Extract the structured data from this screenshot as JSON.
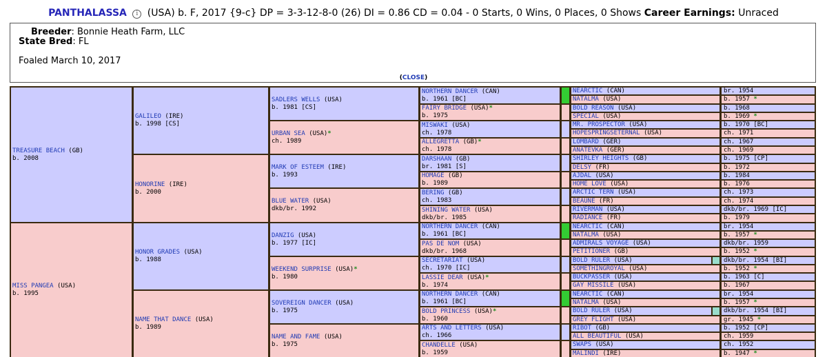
{
  "header": {
    "horse_name": "PANTHALASSA",
    "info_icon": "info-icon",
    "details": "(USA) b. F, 2017 {9-c} DP = 3-3-12-8-0 (26) DI = 0.86   CD = 0.04 - 0 Starts, 0 Wins, 0 Places, 0 Shows",
    "earnings_label": "Career Earnings:",
    "earnings_value": "Unraced"
  },
  "info": {
    "breeder_label": "Breeder",
    "breeder_value": ": Bonnie Heath Farm, LLC",
    "state_label": "State Bred",
    "state_value": ": FL",
    "foaled": "Foaled March 10, 2017",
    "close_paren_open": "(",
    "close_label": "CLOSE",
    "close_paren_close": ")"
  },
  "colors": {
    "male_bg": "#ccccff",
    "female_bg": "#f8cccc",
    "border": "#3a2a10",
    "link": "#1f3ab4",
    "star": "#1e8c1e",
    "green_strip": "#33cc33",
    "teal_strip": "#99ddcc"
  },
  "pedigree": {
    "gen1": [
      {
        "name": "TREASURE BEACH",
        "country": "(GB)",
        "line2": "b. 2008",
        "sex": "m"
      },
      {
        "name": "MISS PANGEA",
        "country": "(USA)",
        "line2": "b. 1995",
        "sex": "f"
      }
    ],
    "gen2": [
      {
        "name": "GALILEO",
        "country": "(IRE)",
        "line2": "b. 1998 [CS]",
        "sex": "m"
      },
      {
        "name": "HONORINE",
        "country": "(IRE)",
        "line2": "b. 2000",
        "sex": "f"
      },
      {
        "name": "HONOR GRADES",
        "country": "(USA)",
        "line2": "b. 1988",
        "sex": "m"
      },
      {
        "name": "NAME THAT DANCE",
        "country": "(USA)",
        "line2": "b. 1989",
        "sex": "f"
      }
    ],
    "gen3": [
      {
        "name": "SADLERS WELLS",
        "country": "(USA)",
        "line2": "b. 1981 [CS]",
        "sex": "m"
      },
      {
        "name": "URBAN SEA",
        "country": "(USA)",
        "star": "*",
        "line2": "ch. 1989",
        "sex": "f"
      },
      {
        "name": "MARK OF ESTEEM",
        "country": "(IRE)",
        "line2": "b. 1993",
        "sex": "m"
      },
      {
        "name": "BLUE WATER",
        "country": "(USA)",
        "line2": "dkb/br. 1992",
        "sex": "f"
      },
      {
        "name": "DANZIG",
        "country": "(USA)",
        "line2": "b. 1977 [IC]",
        "sex": "m"
      },
      {
        "name": "WEEKEND SURPRISE",
        "country": "(USA)",
        "star": "*",
        "line2": "b. 1980",
        "sex": "f"
      },
      {
        "name": "SOVEREIGN DANCER",
        "country": "(USA)",
        "line2": "b. 1975",
        "sex": "m"
      },
      {
        "name": "NAME AND FAME",
        "country": "(USA)",
        "line2": "b. 1975",
        "sex": "f"
      }
    ],
    "gen4": [
      {
        "name": "NORTHERN DANCER",
        "country": "(CAN)",
        "line2": "b. 1961 [BC]",
        "sex": "m"
      },
      {
        "name": "FAIRY BRIDGE",
        "country": "(USA)",
        "star": "*",
        "line2": "b. 1975",
        "sex": "f"
      },
      {
        "name": "MISWAKI",
        "country": "(USA)",
        "line2": "ch. 1978",
        "sex": "m"
      },
      {
        "name": "ALLEGRETTA",
        "country": "(GB)",
        "star": "*",
        "line2": "ch. 1978",
        "sex": "f"
      },
      {
        "name": "DARSHAAN",
        "country": "(GB)",
        "line2": "br. 1981 [S]",
        "sex": "m"
      },
      {
        "name": "HOMAGE",
        "country": "(GB)",
        "line2": "b. 1989",
        "sex": "f"
      },
      {
        "name": "BERING",
        "country": "(GB)",
        "line2": "ch. 1983",
        "sex": "m"
      },
      {
        "name": "SHINING WATER",
        "country": "(USA)",
        "line2": "dkb/br. 1985",
        "sex": "f"
      },
      {
        "name": "NORTHERN DANCER",
        "country": "(CAN)",
        "line2": "b. 1961 [BC]",
        "sex": "m"
      },
      {
        "name": "PAS DE NOM",
        "country": "(USA)",
        "line2": "dkb/br. 1968",
        "sex": "f"
      },
      {
        "name": "SECRETARIAT",
        "country": "(USA)",
        "line2": "ch. 1970 [IC]",
        "sex": "m"
      },
      {
        "name": "LASSIE DEAR",
        "country": "(USA)",
        "star": "*",
        "line2": "b. 1974",
        "sex": "f"
      },
      {
        "name": "NORTHERN DANCER",
        "country": "(CAN)",
        "line2": "b. 1961 [BC]",
        "sex": "m"
      },
      {
        "name": "BOLD PRINCESS",
        "country": "(USA)",
        "star": "*",
        "line2": "b. 1960",
        "sex": "f"
      },
      {
        "name": "ARTS AND LETTERS",
        "country": "(USA)",
        "line2": "ch. 1966",
        "sex": "m"
      },
      {
        "name": "CHANDELLE",
        "country": "(USA)",
        "line2": "b. 1959",
        "sex": "f"
      }
    ],
    "gen5": [
      {
        "name": "NEARCTIC",
        "country": "(CAN)",
        "year": "br. 1954",
        "sex": "m"
      },
      {
        "name": "NATALMA",
        "country": "(USA)",
        "year": "b. 1957",
        "star": "*",
        "sex": "f"
      },
      {
        "name": "BOLD REASON",
        "country": "(USA)",
        "year": "b. 1968",
        "sex": "m"
      },
      {
        "name": "SPECIAL",
        "country": "(USA)",
        "year": "b. 1969",
        "star": "*",
        "sex": "f"
      },
      {
        "name": "MR. PROSPECTOR",
        "country": "(USA)",
        "year": "b. 1970 [BC]",
        "sex": "m"
      },
      {
        "name": "HOPESPRINGSETERNAL",
        "country": "(USA)",
        "year": "ch. 1971",
        "sex": "f"
      },
      {
        "name": "LOMBARD",
        "country": "(GER)",
        "year": "ch. 1967",
        "sex": "m"
      },
      {
        "name": "ANATEVKA",
        "country": "(GER)",
        "year": "ch. 1969",
        "sex": "f"
      },
      {
        "name": "SHIRLEY HEIGHTS",
        "country": "(GB)",
        "year": "b. 1975 [CP]",
        "sex": "m"
      },
      {
        "name": "DELSY",
        "country": "(FR)",
        "year": "b. 1972",
        "sex": "f"
      },
      {
        "name": "AJDAL",
        "country": "(USA)",
        "year": "b. 1984",
        "sex": "m"
      },
      {
        "name": "HOME LOVE",
        "country": "(USA)",
        "year": "b. 1976",
        "sex": "f"
      },
      {
        "name": "ARCTIC TERN",
        "country": "(USA)",
        "year": "ch. 1973",
        "sex": "m"
      },
      {
        "name": "BEAUNE",
        "country": "(FR)",
        "year": "ch. 1974",
        "sex": "f"
      },
      {
        "name": "RIVERMAN",
        "country": "(USA)",
        "year": "dkb/br. 1969 [IC]",
        "sex": "m"
      },
      {
        "name": "RADIANCE",
        "country": "(FR)",
        "year": "b. 1979",
        "sex": "f"
      },
      {
        "name": "NEARCTIC",
        "country": "(CAN)",
        "year": "br. 1954",
        "sex": "m"
      },
      {
        "name": "NATALMA",
        "country": "(USA)",
        "year": "b. 1957",
        "star": "*",
        "sex": "f"
      },
      {
        "name": "ADMIRALS VOYAGE",
        "country": "(USA)",
        "year": "dkb/br. 1959",
        "sex": "m"
      },
      {
        "name": "PETITIONER",
        "country": "(GB)",
        "year": "b. 1952",
        "star": "*",
        "sex": "f"
      },
      {
        "name": "BOLD RULER",
        "country": "(USA)",
        "year": "dkb/br. 1954 [BI]",
        "sex": "m"
      },
      {
        "name": "SOMETHINGROYAL",
        "country": "(USA)",
        "year": "b. 1952",
        "star": "*",
        "sex": "f"
      },
      {
        "name": "BUCKPASSER",
        "country": "(USA)",
        "year": "b. 1963 [C]",
        "sex": "m"
      },
      {
        "name": "GAY MISSILE",
        "country": "(USA)",
        "year": "b. 1967",
        "sex": "f"
      },
      {
        "name": "NEARCTIC",
        "country": "(CAN)",
        "year": "br. 1954",
        "sex": "m"
      },
      {
        "name": "NATALMA",
        "country": "(USA)",
        "year": "b. 1957",
        "star": "*",
        "sex": "f"
      },
      {
        "name": "BOLD RULER",
        "country": "(USA)",
        "year": "dkb/br. 1954 [BI]",
        "sex": "m"
      },
      {
        "name": "GREY FLIGHT",
        "country": "(USA)",
        "year": "gr. 1945",
        "star": "*",
        "sex": "f"
      },
      {
        "name": "RIBOT",
        "country": "(GB)",
        "year": "b. 1952 [CP]",
        "sex": "m"
      },
      {
        "name": "ALL BEAUTIFUL",
        "country": "(USA)",
        "year": "ch. 1959",
        "sex": "f"
      },
      {
        "name": "SWAPS",
        "country": "(USA)",
        "year": "ch. 1952",
        "sex": "m"
      },
      {
        "name": "MALINDI",
        "country": "(IRE)",
        "year": "b. 1947",
        "star": "*",
        "sex": "f"
      }
    ]
  }
}
